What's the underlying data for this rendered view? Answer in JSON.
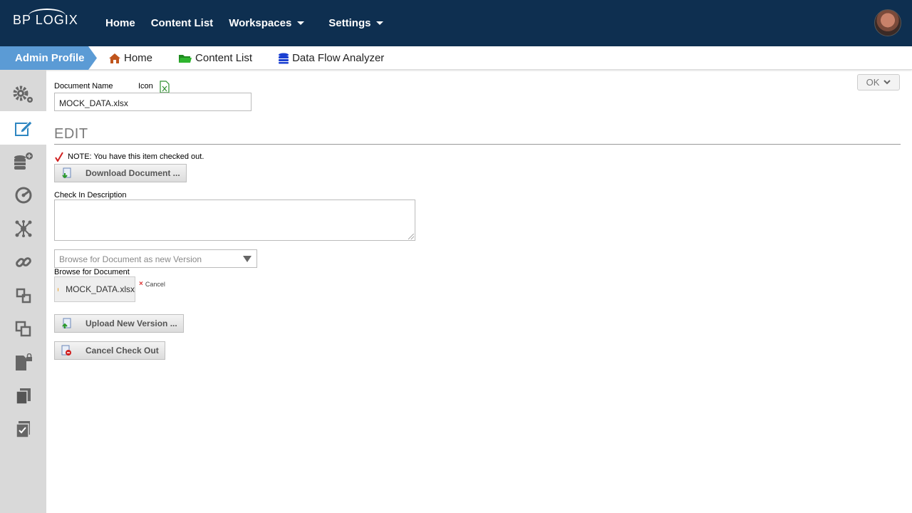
{
  "header": {
    "logo_text": "BP LOGIX",
    "nav": [
      {
        "label": "Home"
      },
      {
        "label": "Content List"
      },
      {
        "label": "Workspaces"
      },
      {
        "label": "Settings"
      }
    ]
  },
  "breadcrumb": {
    "current": "Admin Profile",
    "links": [
      {
        "label": "Home",
        "icon": "home-icon"
      },
      {
        "label": "Content List",
        "icon": "folder-icon"
      },
      {
        "label": "Data Flow Analyzer",
        "icon": "database-icon"
      }
    ]
  },
  "sidebar": {
    "items": [
      {
        "icon": "gears-icon"
      },
      {
        "icon": "edit-icon",
        "active": true
      },
      {
        "icon": "database-add-icon"
      },
      {
        "icon": "dashboard-gauge-icon"
      },
      {
        "icon": "network-icon"
      },
      {
        "icon": "link-icon"
      },
      {
        "icon": "move-icon"
      },
      {
        "icon": "copy-boxes-icon"
      },
      {
        "icon": "locked-document-icon"
      },
      {
        "icon": "documents-icon"
      },
      {
        "icon": "checked-clipboard-icon"
      }
    ]
  },
  "form": {
    "document_name_label": "Document Name",
    "icon_label": "Icon",
    "document_name_value": "MOCK_DATA.xlsx",
    "ok_label": "OK",
    "section_title": "EDIT",
    "note": "NOTE: You have this item checked out.",
    "download_label": "Download Document ...",
    "check_in_label": "Check In Description",
    "check_in_value": "",
    "browse_select_label": "Browse for Document as new Version",
    "browse_label": "Browse for Document",
    "file_name": "MOCK_DATA.xlsx",
    "cancel_label": "Cancel",
    "upload_label": "Upload New Version ...",
    "cancel_checkout_label": "Cancel Check Out"
  },
  "colors": {
    "topbar": "#0e2f50",
    "breadcrumb_active": "#5b9bd5",
    "sidebar_bg": "#d9d9d9",
    "accent_blue": "#2e86c1"
  }
}
